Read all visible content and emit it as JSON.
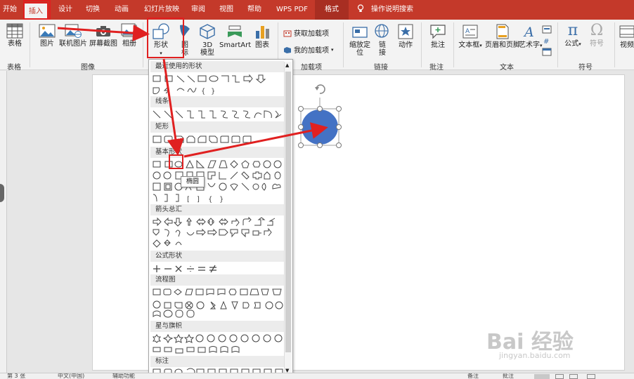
{
  "tabs": {
    "home": "开始",
    "insert": "插入",
    "design": "设计",
    "transitions": "切换",
    "animations": "动画",
    "slideshow": "幻灯片放映",
    "review": "审阅",
    "view": "视图",
    "help": "帮助",
    "wps": "WPS PDF",
    "format": "格式",
    "search": "操作说明搜索"
  },
  "ribbon": {
    "table": "表格",
    "picture": "图片",
    "online_picture": "联机图片",
    "screenshot": "屏幕截图",
    "album": "相册",
    "shapes": "形状",
    "icons_top": "图",
    "icons_bottom": "标",
    "model_top": "3D",
    "model_bottom": "模型",
    "smartart": "SmartArt",
    "chart": "图表",
    "get_addins": "获取加载项",
    "my_addins": "我的加载项",
    "zoom_top": "缩放定",
    "zoom_bottom": "位",
    "link_top": "链",
    "link_bottom": "接",
    "action": "动作",
    "comment": "批注",
    "textbox": "文本框",
    "header_footer": "页眉和页脚",
    "wordart": "艺术字",
    "equation": "公式",
    "symbol": "符号",
    "video": "视频",
    "groups": {
      "tables": "表格",
      "images": "图像",
      "addins": "加载项",
      "links": "链接",
      "comments": "批注",
      "text": "文本",
      "symbols": "符号"
    }
  },
  "gallery": {
    "recent": "最近使用的形状",
    "lines": "线条",
    "rectangles": "矩形",
    "basic": "基本形状",
    "arrows": "箭头总汇",
    "equation": "公式形状",
    "flowchart": "流程图",
    "stars": "星与旗帜",
    "callouts": "标注",
    "tooltip": "椭圆"
  },
  "statusbar": {
    "slide": "第 3 张",
    "lang": "中文(中国)",
    "accessibility": "辅助功能",
    "notes": "备注",
    "comments": "批注"
  },
  "watermark": {
    "brand": "Bai 经验",
    "url": "jingyan.baidu.com"
  },
  "colors": {
    "tabbar": "#c4392a",
    "accent_red": "#e02020",
    "circle_fill": "#4472c4"
  }
}
